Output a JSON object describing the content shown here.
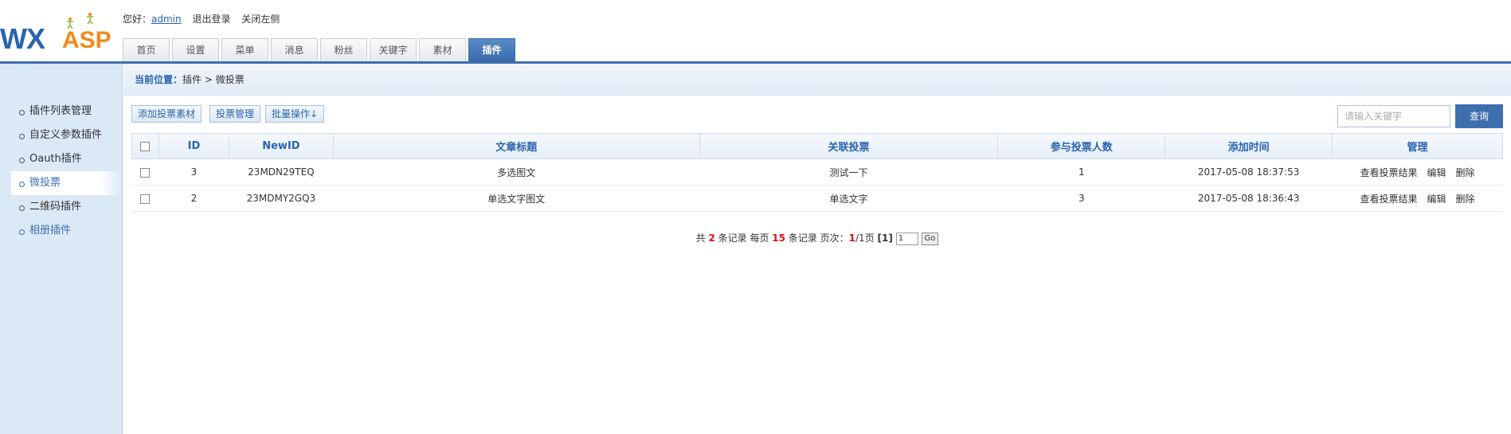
{
  "header": {
    "logo_wx": "WX",
    "logo_asp": "ASP",
    "greeting": "您好：",
    "username": "admin",
    "logout": "退出登录",
    "close_left": "关闭左侧"
  },
  "nav": {
    "tabs": [
      "首页",
      "设置",
      "菜单",
      "消息",
      "粉丝",
      "关键字",
      "素材",
      "插件"
    ],
    "active": "插件"
  },
  "sidebar": {
    "items": [
      "插件列表管理",
      "自定义参数插件",
      "Oauth插件",
      "微投票",
      "二维码插件",
      "相册插件"
    ],
    "active": "微投票"
  },
  "breadcrumb": {
    "label": "当前位置：",
    "path": "插件 > 微投票"
  },
  "toolbar": {
    "add_label": "添加投票素材",
    "manage_label": "投票管理",
    "batch_label": "批量操作↓",
    "search_placeholder": "请输入关键字",
    "search_button": "查询"
  },
  "table": {
    "headers": [
      "ID",
      "NewID",
      "文章标题",
      "关联投票",
      "参与投票人数",
      "添加时间",
      "管理"
    ],
    "rows": [
      {
        "id": "3",
        "newid": "23MDN29TEQ",
        "title": "多选图文",
        "vote": "测试一下",
        "count": "1",
        "time": "2017-05-08 18:37:53"
      },
      {
        "id": "2",
        "newid": "23MDMY2GQ3",
        "title": "单选文字图文",
        "vote": "单选文字",
        "count": "3",
        "time": "2017-05-08 18:36:43"
      }
    ],
    "actions": [
      "查看投票结果",
      "编辑",
      "删除"
    ]
  },
  "pager": {
    "prefix": "共",
    "total": "2",
    "records_per": "条记录 每页",
    "per_page": "15",
    "pages_label": "条记录 页次：",
    "current": "1",
    "pages_total": "/1页",
    "page_list": "[1]",
    "page_input": "1",
    "go": "Go"
  }
}
